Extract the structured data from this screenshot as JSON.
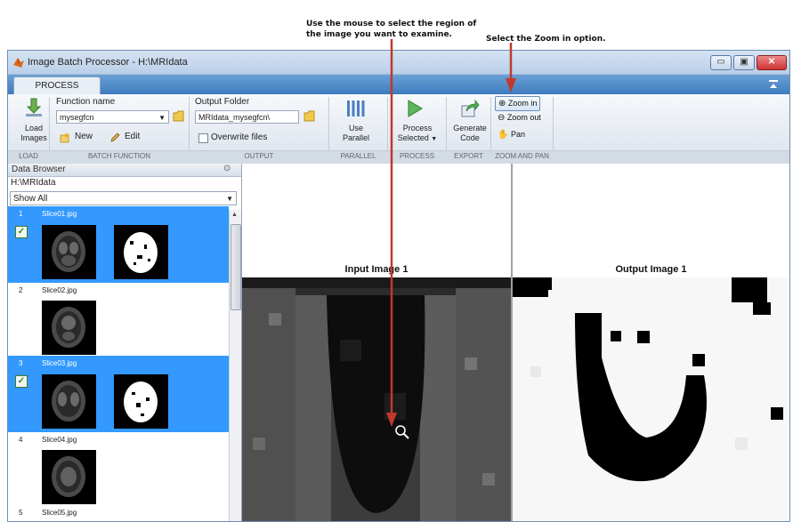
{
  "annotations": {
    "mouse_note_line1": "Use the mouse to select the region of",
    "mouse_note_line2": "the image you want to examine.",
    "zoom_note": "Select the Zoom in option."
  },
  "window": {
    "title": "Image Batch Processor - H:\\MRIdata",
    "minimize_glyph": "▭",
    "maximize_glyph": "▣",
    "close_glyph": "✕"
  },
  "ribbon": {
    "tab_process": "PROCESS",
    "load": {
      "label_line1": "Load",
      "label_line2": "Images",
      "section": "LOAD"
    },
    "batch_function": {
      "function_name_label": "Function name",
      "function_name_value": "mysegfcn",
      "new_label": "New",
      "edit_label": "Edit",
      "section": "BATCH FUNCTION"
    },
    "output": {
      "output_folder_label": "Output Folder",
      "output_folder_value": "MRIdata_mysegfcn\\",
      "overwrite_label": "Overwrite files",
      "overwrite_checked": false,
      "section": "OUTPUT"
    },
    "parallel": {
      "label_line1": "Use",
      "label_line2": "Parallel",
      "section": "PARALLEL"
    },
    "process": {
      "label_line1": "Process",
      "label_line2": "Selected",
      "section": "PROCESS"
    },
    "export": {
      "label_line1": "Generate",
      "label_line2": "Code",
      "section": "EXPORT"
    },
    "zoom": {
      "zoom_in": "Zoom in",
      "zoom_out": "Zoom out",
      "pan": "Pan",
      "section": "ZOOM AND PAN",
      "selected": "zoom_in"
    }
  },
  "data_browser": {
    "header": "Data Browser",
    "path": "H:\\MRIdata",
    "filter": "Show All",
    "items": [
      {
        "num": "1",
        "name": "Slice01.jpg",
        "selected": true,
        "checked": true,
        "has_output": true
      },
      {
        "num": "2",
        "name": "Slice02.jpg",
        "selected": false,
        "checked": false,
        "has_output": false
      },
      {
        "num": "3",
        "name": "Slice03.jpg",
        "selected": true,
        "checked": true,
        "has_output": true
      },
      {
        "num": "4",
        "name": "Slice04.jpg",
        "selected": false,
        "checked": false,
        "has_output": false
      },
      {
        "num": "5",
        "name": "Slice05.jpg",
        "selected": false,
        "checked": false,
        "has_output": false
      }
    ]
  },
  "viewer": {
    "input_title": "Input Image 1",
    "output_title": "Output Image 1"
  },
  "colors": {
    "selection_blue": "#3399ff",
    "arrow_red": "#c0392b",
    "ribbon_tab_blue": "#3f7bbd"
  }
}
